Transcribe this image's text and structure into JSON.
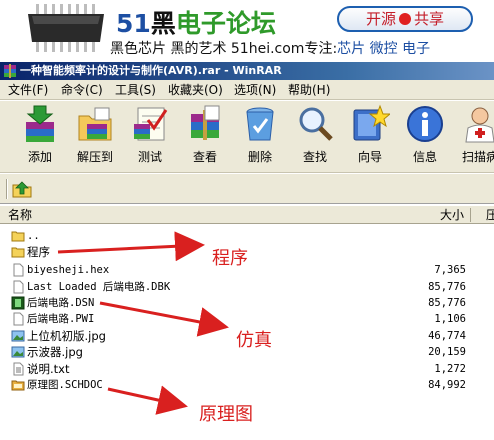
{
  "banner": {
    "brand_51": "51",
    "brand_hei": "黑",
    "brand_rest": "电子论坛",
    "open_left": "开源",
    "open_right": "共享",
    "tagline_a": "黑色芯片 黑的艺术",
    "tagline_b": " 51hei.com专注:",
    "tagline_c": "芯片 微控 电子"
  },
  "window": {
    "title": "一种智能频率计的设计与制作(AVR).rar - WinRAR"
  },
  "menu": [
    "文件(F)",
    "命令(C)",
    "工具(S)",
    "收藏夹(O)",
    "选项(N)",
    "帮助(H)"
  ],
  "toolbar": [
    "添加",
    "解压到",
    "测试",
    "查看",
    "删除",
    "查找",
    "向导",
    "信息",
    "扫描病"
  ],
  "list": {
    "header_name": "名称",
    "header_size": "大小",
    "header_packed": "压",
    "rows": [
      {
        "name": "..",
        "size": "",
        "icon": "folder-up-icon"
      },
      {
        "name": "程序",
        "size": "",
        "icon": "folder-icon"
      },
      {
        "name": "biyesheji.hex",
        "size": "7,365",
        "icon": "file-icon"
      },
      {
        "name": "Last Loaded 后端电路.DBK",
        "size": "85,776",
        "icon": "file-icon"
      },
      {
        "name": "后端电路.DSN",
        "size": "85,776",
        "icon": "proteus-file-icon"
      },
      {
        "name": "后端电路.PWI",
        "size": "1,106",
        "icon": "file-icon"
      },
      {
        "name": "上位机初版.jpg",
        "size": "46,774",
        "icon": "image-file-icon"
      },
      {
        "name": "示波器.jpg",
        "size": "20,159",
        "icon": "image-file-icon"
      },
      {
        "name": "说明.txt",
        "size": "1,272",
        "icon": "text-file-icon"
      },
      {
        "name": "原理图.SCHDOC",
        "size": "84,992",
        "icon": "schematic-file-icon"
      }
    ]
  },
  "annotations": {
    "program": "程序",
    "simulation": "仿真",
    "schematic": "原理图",
    "color": "#d9201f"
  }
}
